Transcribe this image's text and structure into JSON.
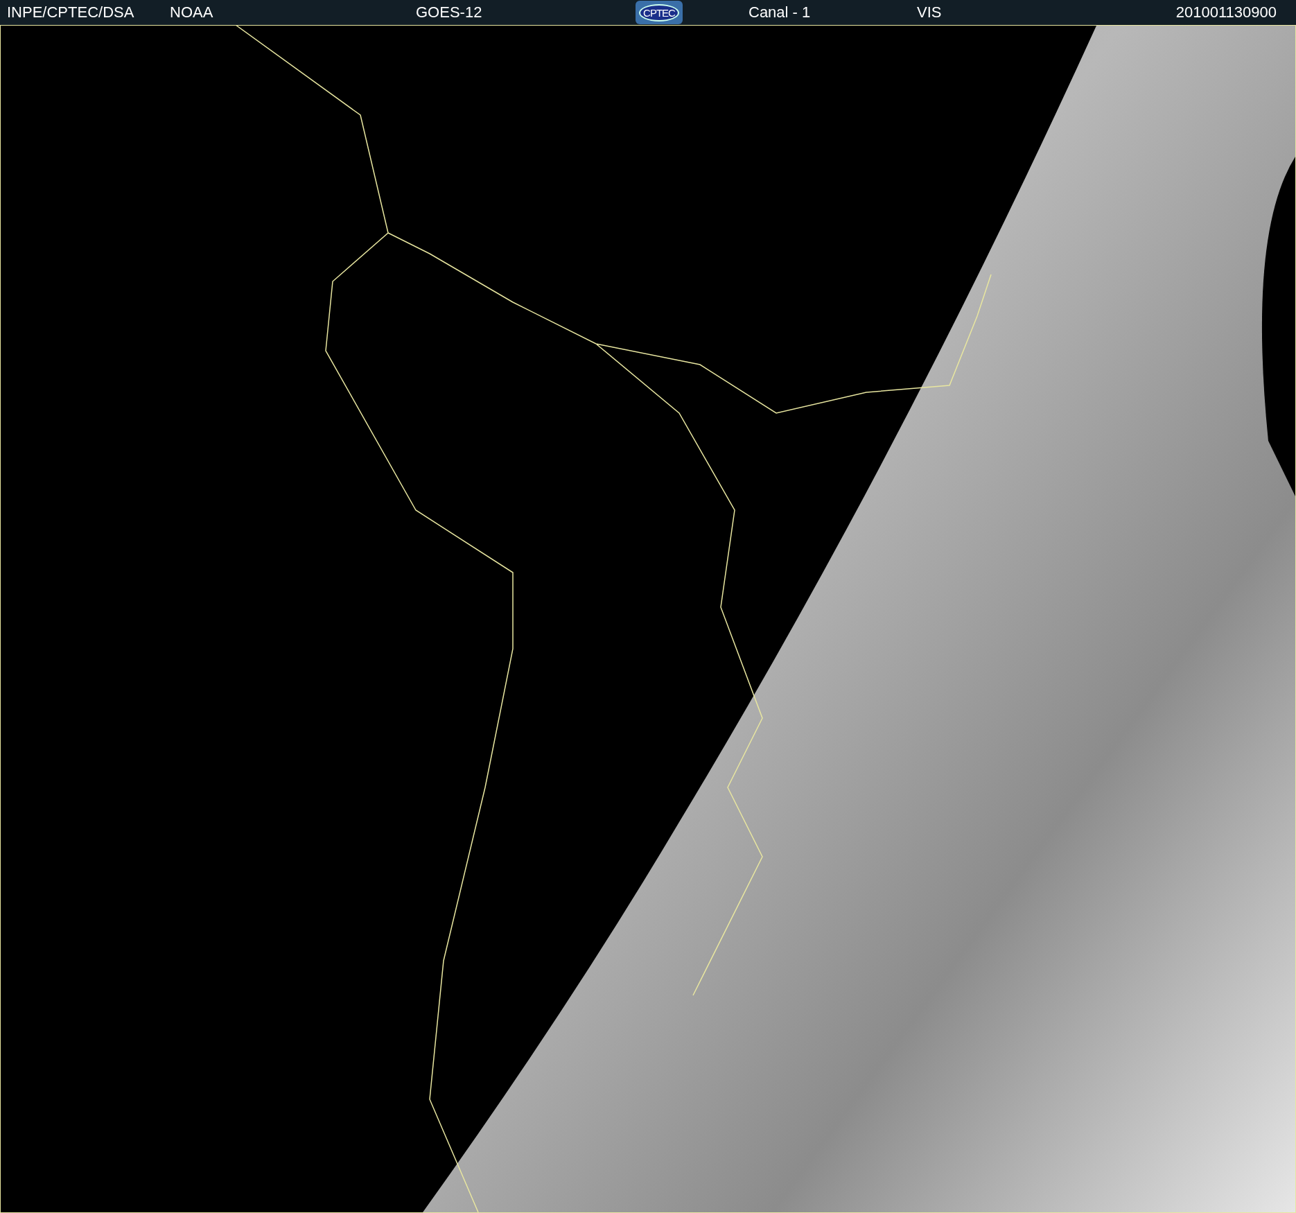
{
  "header": {
    "source": "INPE/CPTEC/DSA",
    "agency": "NOAA",
    "satellite": "GOES-12",
    "logo": "CPTEC",
    "channel": "Canal - 1",
    "band": "VIS",
    "timestamp": "201001130900"
  }
}
